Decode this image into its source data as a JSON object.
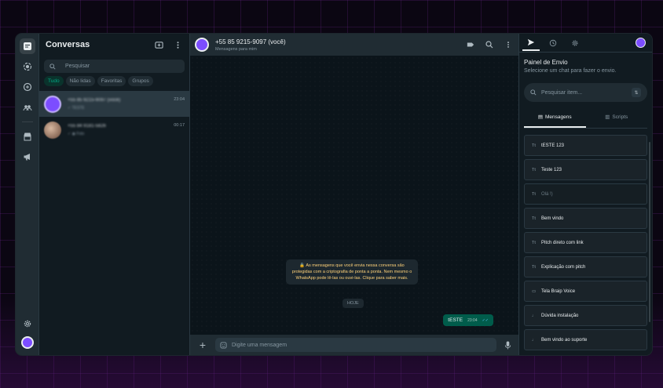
{
  "colors": {
    "accent": "#00a884",
    "brand": "#7c4dff",
    "outgoing": "#005c4b"
  },
  "chatlist": {
    "title": "Conversas",
    "search_placeholder": "Pesquisar",
    "filters": [
      "Tudo",
      "Não lidas",
      "Favoritas",
      "Grupos"
    ],
    "chats": [
      {
        "name": "+55 85 9215-9097 (você)",
        "preview": "✓ TESTE",
        "time": "23:04",
        "avatar_color": "#7c4dff"
      },
      {
        "name": "+55 84 9181-5826",
        "preview": "✓ ◉ Foto",
        "time": "00:17",
        "avatar_color": "#a08070"
      }
    ]
  },
  "conversation": {
    "name": "+55 85 9215-9097 (você)",
    "subtitle": "Mensagens para mim",
    "encryption_notice": "🔒 As mensagens que você envia nessa conversa são protegidas com a criptografia de ponta a ponta. Nem mesmo o WhatsApp pode lê-las ou ouvi-las. Clique para saber mais.",
    "date_label": "HOJE",
    "messages": [
      {
        "text": "tESTE",
        "time": "23:04",
        "ticks": "✓✓"
      }
    ],
    "input_placeholder": "Digite uma mensagem"
  },
  "panel": {
    "title": "Painel de Envio",
    "subtitle": "Selecione um chat para fazer o envio.",
    "search_placeholder": "Pesquisar item...",
    "tabs": [
      "Mensagens",
      "Scripts"
    ],
    "items": [
      {
        "type": "Tt",
        "label": "tESTE 123"
      },
      {
        "type": "Tt",
        "label": "Teste 123"
      },
      {
        "type": "Tt",
        "label": "Olá !)",
        "dim": true
      },
      {
        "type": "Tt",
        "label": "Bem vindo"
      },
      {
        "type": "Tt",
        "label": "Pitch direto com link"
      },
      {
        "type": "Tt",
        "label": "Explicação com pitch"
      },
      {
        "type": "▭",
        "label": "Tela Braip Voice"
      },
      {
        "type": "♩",
        "label": "Dúvida instalação"
      },
      {
        "type": "♩",
        "label": "Bem vindo ao suporte"
      }
    ]
  }
}
